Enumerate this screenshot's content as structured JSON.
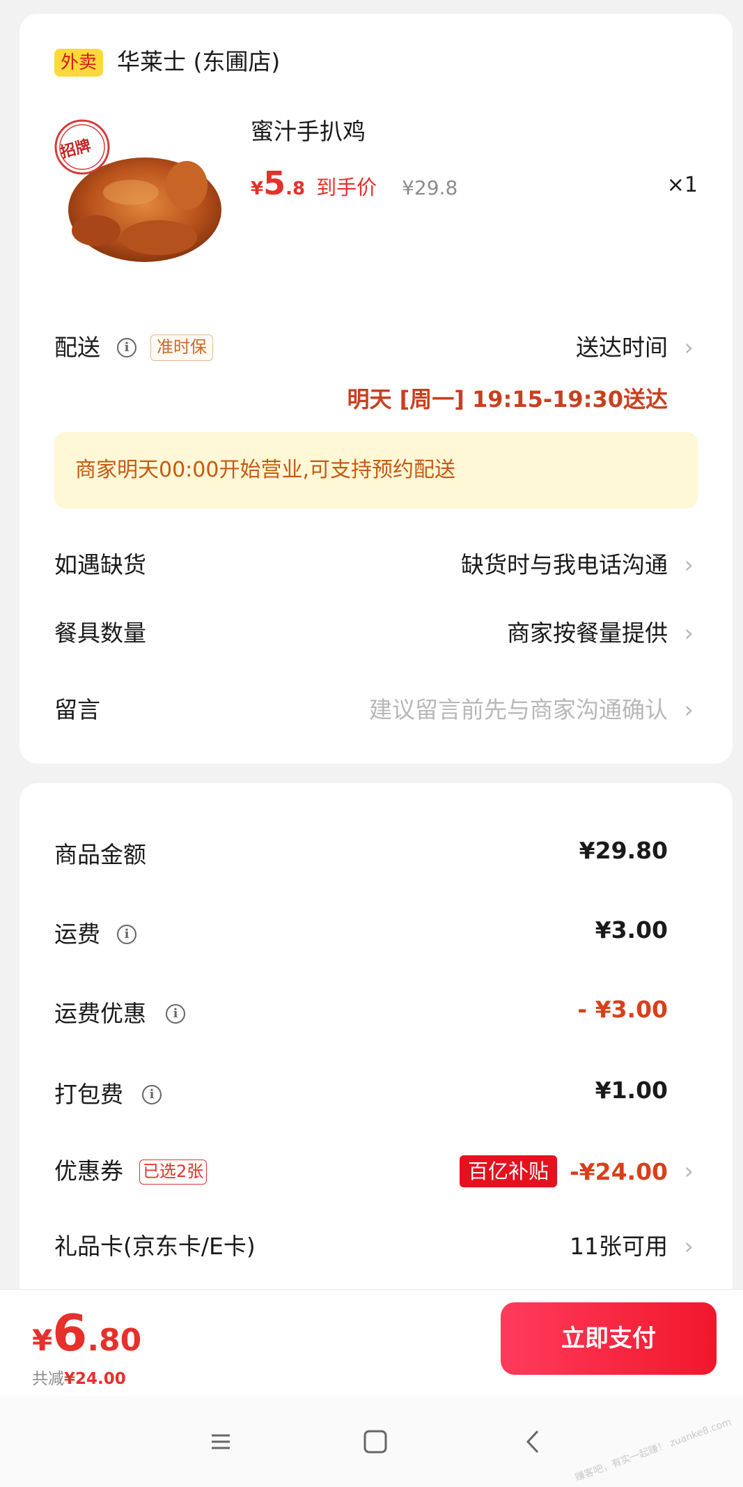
{
  "store": {
    "tag": "外卖",
    "name": "华莱士 (东圃店)"
  },
  "item": {
    "image_icon": "roast-chicken-image",
    "badge": "招牌",
    "name": "蜜汁手扒鸡",
    "price_symbol": "¥",
    "price_int": "5",
    "price_dec": ".8",
    "price_label": "到手价",
    "original_price": "¥29.8",
    "quantity": "×1"
  },
  "delivery": {
    "label": "配送",
    "badge": "准时保",
    "time_label": "送达时间",
    "time_value": "明天 [周一] 19:15-19:30送达"
  },
  "notice": "商家明天00:00开始营业,可支持预约配送",
  "options": [
    {
      "label": "如遇缺货",
      "value": "缺货时与我电话沟通"
    },
    {
      "label": "餐具数量",
      "value": "商家按餐量提供"
    },
    {
      "label": "留言",
      "value": "建议留言前先与商家沟通确认"
    }
  ],
  "fees": {
    "goods_amount": {
      "label": "商品金额",
      "value": "¥29.80"
    },
    "shipping": {
      "label": "运费",
      "value": "¥3.00"
    },
    "shipping_discount": {
      "label": "运费优惠",
      "value": "- ¥3.00"
    },
    "packing": {
      "label": "打包费",
      "value": "¥1.00"
    },
    "coupon": {
      "label": "优惠券",
      "badge": "已选2张",
      "subsidy": "百亿补贴",
      "value": "-¥24.00"
    },
    "gift_card": {
      "label": "礼品卡(京东卡/E卡)",
      "value": "11张可用"
    }
  },
  "footer": {
    "total_symbol": "¥",
    "total_int": "6",
    "total_dec": ".80",
    "saved_label": "共减",
    "saved_value": "¥24.00",
    "pay_label": "立即支付"
  },
  "watermark": "赚客吧，有实一起赚！ zuanke8.com",
  "colors": {
    "accent_red": "#e6302b",
    "notice_bg": "#fff8d6",
    "tag_yellow": "#ffd93a"
  }
}
